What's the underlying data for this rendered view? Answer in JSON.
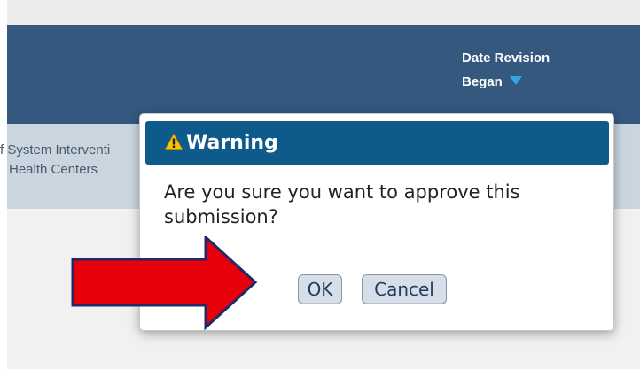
{
  "table": {
    "header": {
      "date_revision_line1": "Date Revision",
      "date_revision_line2": "Began"
    },
    "row": {
      "line1": "f System Interventi",
      "line2": "Health Centers"
    }
  },
  "dialog": {
    "title": "Warning",
    "message": "Are you sure you want to approve this submission?",
    "ok_label": "OK",
    "cancel_label": "Cancel"
  },
  "icons": {
    "title_icon": "warning-triangle-icon",
    "sort_icon": "sort-descending-icon",
    "annotation": "red-arrow-pointer"
  },
  "colors": {
    "header_bg": "#34587e",
    "row_bg": "#c9d6e0",
    "dialog_title_bg": "#0e5a8a",
    "button_bg": "#d8dee8",
    "button_text": "#1b3e66",
    "arrow_fill": "#e8000b",
    "arrow_stroke": "#1f2a66",
    "warning_yellow": "#f5c400"
  }
}
